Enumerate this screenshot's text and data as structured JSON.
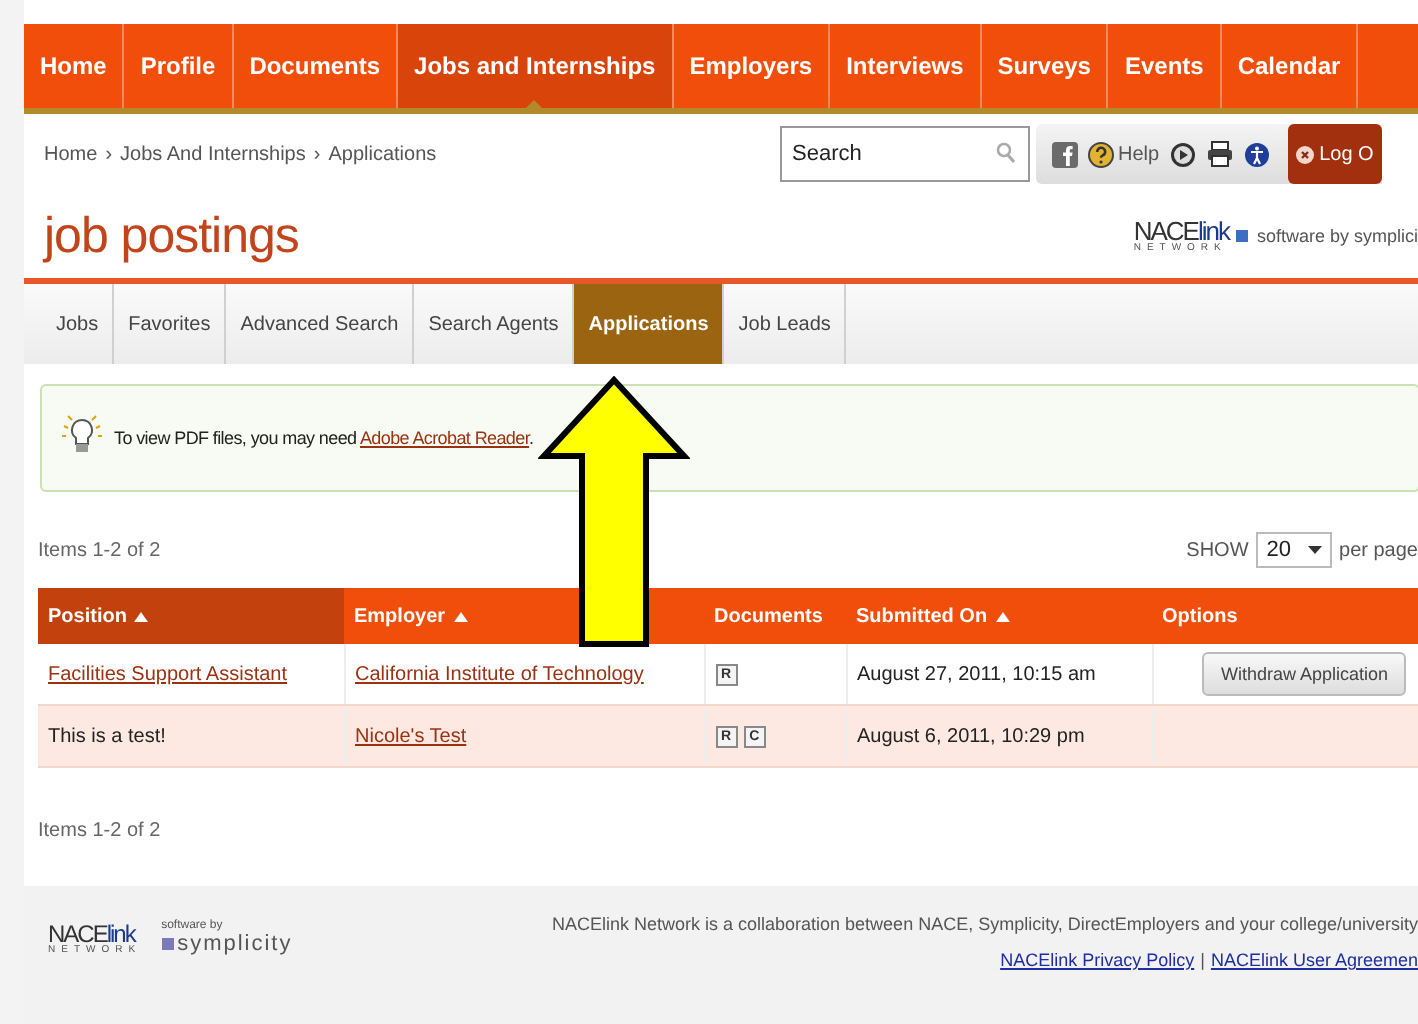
{
  "nav": [
    {
      "label": "Home",
      "selected": false
    },
    {
      "label": "Profile",
      "selected": false
    },
    {
      "label": "Documents",
      "selected": false
    },
    {
      "label": "Jobs and Internships",
      "selected": true
    },
    {
      "label": "Employers",
      "selected": false
    },
    {
      "label": "Interviews",
      "selected": false
    },
    {
      "label": "Surveys",
      "selected": false
    },
    {
      "label": "Events",
      "selected": false
    },
    {
      "label": "Calendar",
      "selected": false
    }
  ],
  "breadcrumb": [
    "Home",
    "Jobs And Internships",
    "Applications"
  ],
  "breadcrumb_separator": "›",
  "search": {
    "placeholder": "Search"
  },
  "toolbar": {
    "help": "Help",
    "logout": "Log O"
  },
  "page_title": "job postings",
  "brand": {
    "logo_main": "NACE",
    "logo_accent": "link",
    "logo_sub": "NETWORK",
    "tagline": "software by symplici"
  },
  "subtabs": [
    {
      "label": "Jobs",
      "selected": false
    },
    {
      "label": "Favorites",
      "selected": false
    },
    {
      "label": "Advanced Search",
      "selected": false
    },
    {
      "label": "Search Agents",
      "selected": false
    },
    {
      "label": "Applications",
      "selected": true
    },
    {
      "label": "Job Leads",
      "selected": false
    }
  ],
  "notice": {
    "text": "To view PDF files, you may need ",
    "link": "Adobe Acrobat Reader",
    "end": "."
  },
  "items_top": "Items 1-2 of 2",
  "page_size": {
    "label": "SHOW",
    "value": "20",
    "suffix": "per page"
  },
  "table": {
    "columns": [
      {
        "label": "Position",
        "sortable": true,
        "sorted": true
      },
      {
        "label": "Employer",
        "sortable": true,
        "sorted": false
      },
      {
        "label": "Documents",
        "sortable": false,
        "sorted": false
      },
      {
        "label": "Submitted On",
        "sortable": true,
        "sorted": false
      },
      {
        "label": "Options",
        "sortable": false,
        "sorted": false
      }
    ],
    "rows": [
      {
        "position": "Facilities Support Assistant",
        "position_link": true,
        "employer": "California Institute of Technology",
        "documents": [
          "R"
        ],
        "submitted": "August 27, 2011, 10:15 am",
        "action": "Withdraw Application",
        "highlighted": false
      },
      {
        "position": "This is a test!",
        "position_link": false,
        "employer": "Nicole's Test",
        "documents": [
          "R",
          "C"
        ],
        "submitted": "August 6, 2011, 10:29 pm",
        "highlighted": true
      }
    ]
  },
  "items_bottom": "Items 1-2 of 2",
  "footer": {
    "logo_main": "NACE",
    "logo_accent": "link",
    "logo_sub": "NETWORK",
    "software_by": "software by",
    "symplicity": "symplicity",
    "text": "NACElink Network is a collaboration between NACE, Symplicity, DirectEmployers and your college/university",
    "links": [
      "NACElink Privacy Policy",
      "NACElink User Agreemen"
    ],
    "link_separator": "|"
  },
  "annotation_arrow": true
}
